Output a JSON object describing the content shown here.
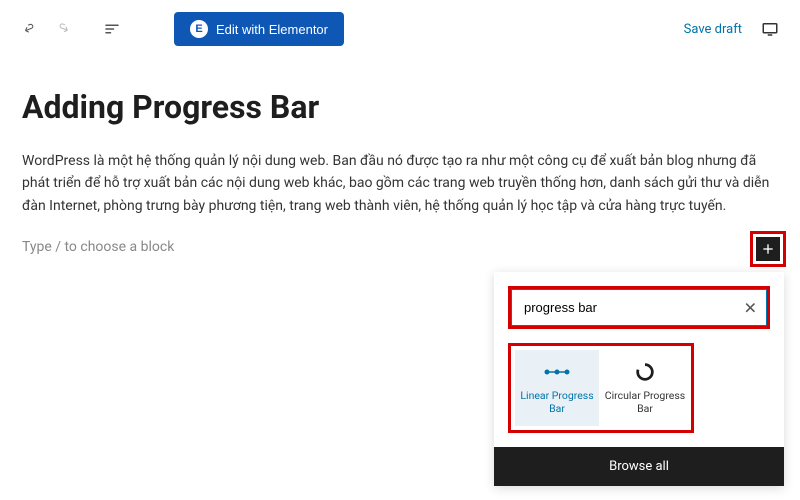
{
  "toolbar": {
    "elementor_label": "Edit with Elementor",
    "elementor_icon_letter": "E",
    "save_draft": "Save draft"
  },
  "post": {
    "title": "Adding Progress Bar",
    "description": "WordPress là một hệ thống quản lý nội dung web. Ban đầu nó được tạo ra như một công cụ để xuất bản blog nhưng đã phát triển để hỗ trợ xuất bản các nội dung web khác, bao gồm các trang web truyền thống hơn, danh sách gửi thư và diễn đàn Internet, phòng trưng bày phương tiện, trang web thành viên, hệ thống quản lý học tập và cửa hàng trực tuyến.",
    "block_placeholder": "Type / to choose a block"
  },
  "inserter": {
    "search_value": "progress bar",
    "blocks": [
      {
        "label": "Linear Progress Bar"
      },
      {
        "label": "Circular Progress Bar"
      }
    ],
    "browse_all": "Browse all"
  }
}
